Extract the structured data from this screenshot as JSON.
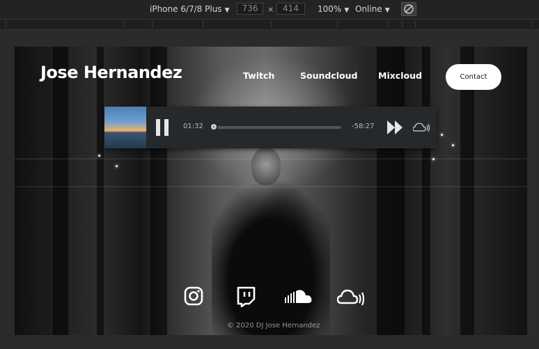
{
  "devtools": {
    "device_label": "iPhone 6/7/8 Plus",
    "width_value": "736",
    "height_value": "414",
    "dimension_separator": "×",
    "zoom_label": "100%",
    "network_label": "Online",
    "rotate_icon": "rotate-icon"
  },
  "site": {
    "title": "Jose Hernandez",
    "nav": [
      {
        "label": "Twitch"
      },
      {
        "label": "Soundcloud"
      },
      {
        "label": "Mixcloud"
      }
    ],
    "contact_label": "Contact"
  },
  "player": {
    "elapsed": "01:32",
    "remaining": "-58:27",
    "progress_fraction": 0.0,
    "icons": [
      "pause-icon",
      "fast-forward-icon",
      "mixcloud-icon"
    ]
  },
  "socials": [
    {
      "icon": "instagram-icon"
    },
    {
      "icon": "twitch-icon"
    },
    {
      "icon": "soundcloud-icon"
    },
    {
      "icon": "mixcloud-icon"
    }
  ],
  "footer": {
    "copyright": "© 2020 DJ Jose Hernandez"
  }
}
